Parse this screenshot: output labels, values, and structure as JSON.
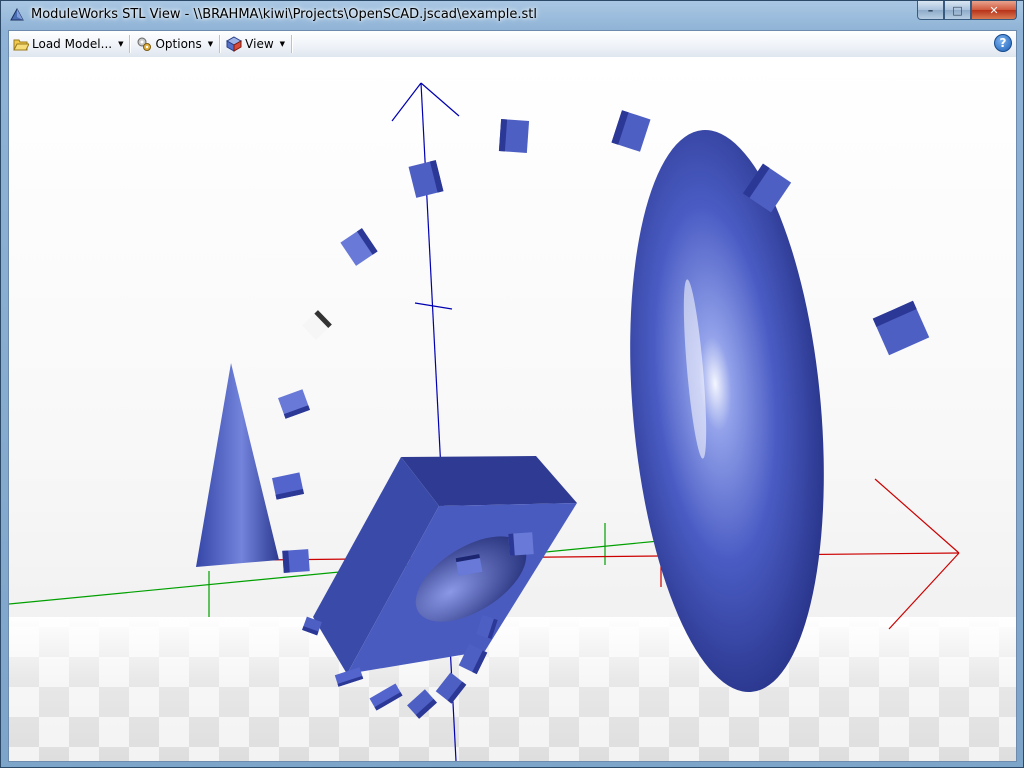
{
  "window": {
    "title": "ModuleWorks STL View - \\\\BRAHMA\\kiwi\\Projects\\OpenSCAD.jscad\\example.stl",
    "controls": {
      "minimize": "–",
      "maximize": "□",
      "close": "✕"
    }
  },
  "toolbar": {
    "load_model": "Load Model...",
    "options": "Options",
    "view": "View",
    "help": "?"
  },
  "scene": {
    "model_color": "#5566c8",
    "axis_colors": {
      "x": "#cc0000",
      "y": "#00a000",
      "z": "#0000b0"
    },
    "floor": "checkerboard"
  }
}
